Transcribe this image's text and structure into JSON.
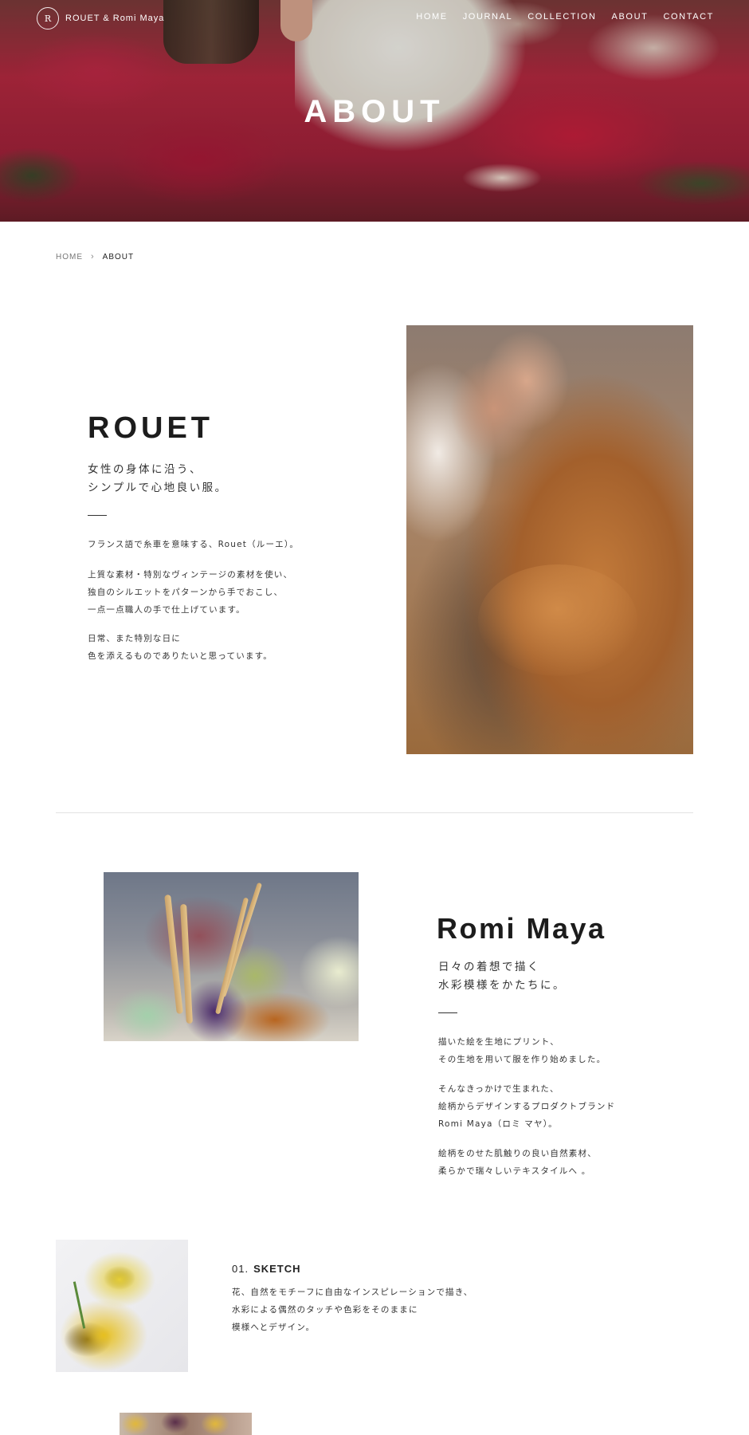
{
  "header": {
    "logo_mark": "R",
    "logo_text": "ROUET & Romi Maya",
    "nav": [
      "HOME",
      "JOURNAL",
      "COLLECTION",
      "ABOUT",
      "CONTACT"
    ]
  },
  "hero": {
    "title": "ABOUT"
  },
  "breadcrumb": {
    "home": "HOME",
    "separator": "›",
    "current": "ABOUT"
  },
  "rouet": {
    "title": "ROUET",
    "tagline": [
      "女性の身体に沿う、",
      "シンプルで心地良い服。"
    ],
    "paragraphs": [
      [
        "フランス語で糸車を意味する、Rouet（ルーエ）。"
      ],
      [
        "上質な素材・特別なヴィンテージの素材を使い、",
        "独自のシルエットをパターンから手でおこし、",
        "一点一点職人の手で仕上げています。"
      ],
      [
        "日常、また特別な日に",
        "色を添えるものでありたいと思っています。"
      ]
    ]
  },
  "romi": {
    "title": "Romi Maya",
    "tagline": [
      "日々の着想で描く",
      "水彩模様をかたちに。"
    ],
    "paragraphs": [
      [
        "描いた絵を生地にプリント、",
        "その生地を用いて服を作り始めました。"
      ],
      [
        "そんなきっかけで生まれた、",
        "絵柄からデザインするプロダクトブランド",
        "Romi Maya（ロミ マヤ）。"
      ],
      [
        "絵柄をのせた肌触りの良い自然素材、",
        "柔らかで瑞々しいテキスタイルへ 。"
      ]
    ]
  },
  "sketch": {
    "number": "01.",
    "name": "SKETCH",
    "lines": [
      "花、自然をモチーフに自由なインスピレーションで描き、",
      "水彩による偶然のタッチや色彩をそのままに",
      "模様へとデザイン。"
    ]
  }
}
